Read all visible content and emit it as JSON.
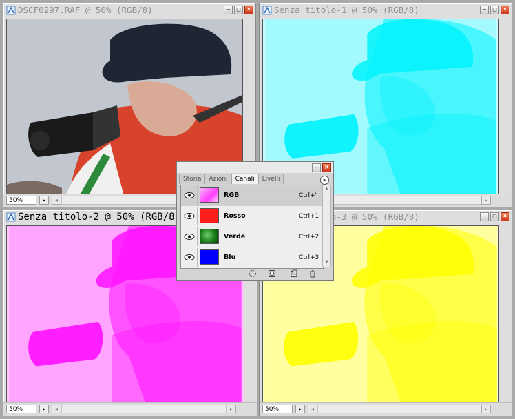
{
  "windows": {
    "w1": {
      "title": "DSCF0297.RAF @ 50% (RGB/8)",
      "zoom": "50%"
    },
    "w2": {
      "title": "Senza titolo-1 @ 50% (RGB/8)",
      "zoom": "50%"
    },
    "w3": {
      "title": "Senza titolo-2 @ 50% (RGB/8)",
      "zoom": "50%"
    },
    "w4": {
      "title": "Senza titolo-3 @ 50% (RGB/8)",
      "zoom": "50%"
    }
  },
  "colors": {
    "cyan": "#00f2fc",
    "magenta": "#ff10ff",
    "yellow": "#ffff00"
  },
  "panel": {
    "tabs": [
      "Storia",
      "Azioni",
      "Canali",
      "Livelli"
    ],
    "selected_tab": "Canali",
    "channels": [
      {
        "name": "RGB",
        "shortcut": "Ctrl+'",
        "thumb": "composite"
      },
      {
        "name": "Rosso",
        "shortcut": "Ctrl+1",
        "thumb": "#ff1e1e"
      },
      {
        "name": "Verde",
        "shortcut": "Ctrl+2",
        "thumb": "#1a7a1a"
      },
      {
        "name": "Blu",
        "shortcut": "Ctrl+3",
        "thumb": "#0000ff"
      }
    ],
    "footer_icons": [
      "load-selection-icon",
      "save-selection-icon",
      "new-channel-icon",
      "trash-icon"
    ]
  }
}
